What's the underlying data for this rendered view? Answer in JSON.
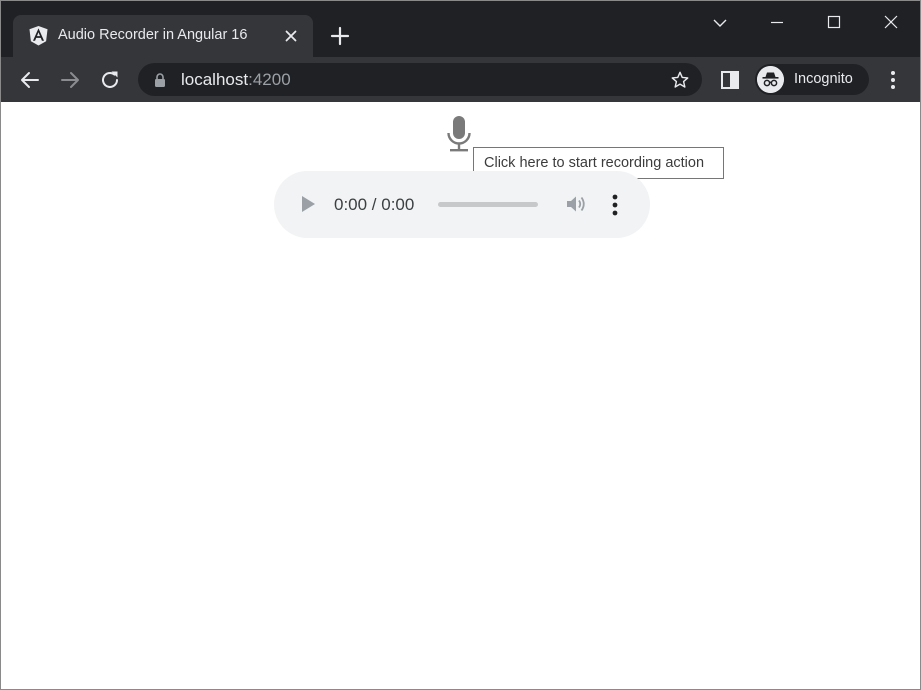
{
  "browser": {
    "tab": {
      "title": "Audio Recorder in Angular 16",
      "favicon": "angular-icon"
    },
    "address_bar": {
      "host": "localhost",
      "port": ":4200"
    },
    "profile": {
      "label": "Incognito",
      "icon": "incognito-icon"
    },
    "colors": {
      "titlebar": "#202124",
      "toolbar": "#35363a",
      "text": "#e8eaed"
    }
  },
  "page": {
    "mic": {
      "icon": "microphone-icon",
      "tooltip": "Click here to start recording action"
    },
    "audio_player": {
      "time": "0:00 / 0:00",
      "progress": 0
    },
    "colors": {
      "mic": "#7a7a7a",
      "player_bg": "#f1f3f4"
    }
  }
}
